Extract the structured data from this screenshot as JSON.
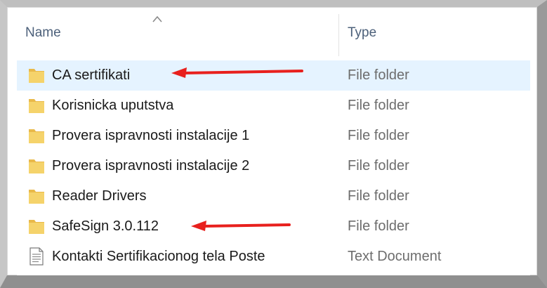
{
  "header": {
    "name_label": "Name",
    "type_label": "Type",
    "sort_icon": "chevron-up-icon"
  },
  "files": [
    {
      "name": "CA sertifikati",
      "type": "File folder",
      "icon": "folder-icon",
      "selected": true,
      "annotated": true
    },
    {
      "name": "Korisnicka uputstva",
      "type": "File folder",
      "icon": "folder-icon"
    },
    {
      "name": "Provera ispravnosti instalacije 1",
      "type": "File folder",
      "icon": "folder-icon"
    },
    {
      "name": "Provera ispravnosti instalacije 2",
      "type": "File folder",
      "icon": "folder-icon"
    },
    {
      "name": "Reader Drivers",
      "type": "File folder",
      "icon": "folder-icon"
    },
    {
      "name": "SafeSign 3.0.112",
      "type": "File folder",
      "icon": "folder-icon",
      "annotated": true
    },
    {
      "name": "Kontakti Sertifikacionog tela Poste",
      "type": "Text Document",
      "icon": "text-document-icon"
    }
  ],
  "colors": {
    "selection": "#e5f3ff",
    "folder": "#f5d36b",
    "annotation_arrow": "#e8201d"
  }
}
